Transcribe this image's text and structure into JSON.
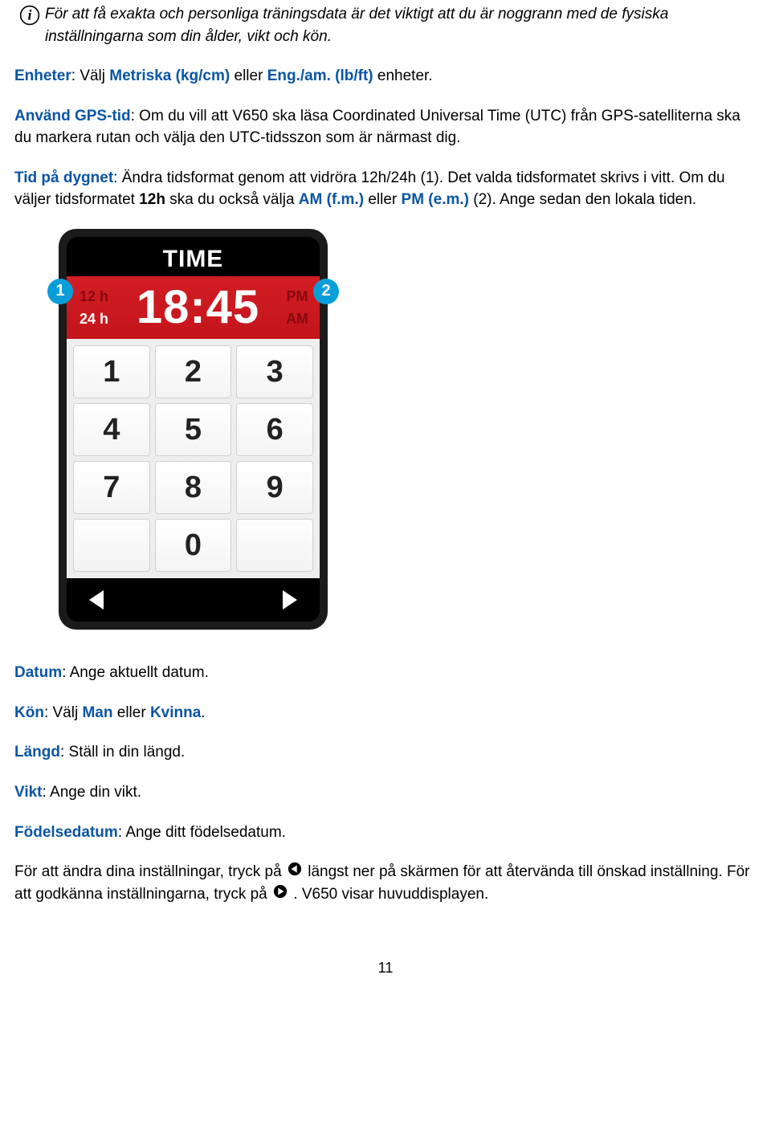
{
  "intro": {
    "line": "För att få exakta och personliga träningsdata är det viktigt att du är noggrann med de fysiska inställningarna som din ålder, vikt och kön."
  },
  "units": {
    "label": "Enheter",
    "sep": ": ",
    "text1": "Välj ",
    "option1": "Metriska (kg/cm)",
    "or": " eller ",
    "option2": "Eng./am. (lb/ft)",
    "text2": " enheter."
  },
  "gps": {
    "label": "Använd GPS-tid",
    "text": ": Om du vill att V650 ska läsa Coordinated Universal Time (UTC) från GPS-satelliterna ska du markera rutan och välja den UTC-tidsszon som är närmast dig."
  },
  "tod": {
    "label": "Tid på dygnet",
    "part1": ": Ändra tidsformat genom att vidröra 12h/24h (1). Det valda tidsformatet skrivs i vitt. Om du väljer tidsformatet ",
    "b1": "12h",
    "part2": " ska du också välja ",
    "b2": "AM (f.m.)",
    "or": " eller ",
    "b3": "PM (e.m.)",
    "part3": " (2). Ange sedan den lokala tiden."
  },
  "device": {
    "title": "TIME",
    "opt12h": "12 h",
    "opt24h": "24 h",
    "clock": "18:45",
    "pm": "PM",
    "am": "AM",
    "keys": [
      "1",
      "2",
      "3",
      "4",
      "5",
      "6",
      "7",
      "8",
      "9",
      "",
      "0",
      ""
    ]
  },
  "callouts": {
    "c1": "1",
    "c2": "2"
  },
  "datum": {
    "label": "Datum",
    "text": ": Ange aktuellt datum."
  },
  "kon": {
    "label": "Kön",
    "sep": ": ",
    "t1": "Välj ",
    "b1": "Man",
    "or": " eller ",
    "b2": "Kvinna",
    "t2": "."
  },
  "langd": {
    "label": "Längd",
    "text": ": Ställ in din längd."
  },
  "vikt": {
    "label": "Vikt",
    "text": ": Ange din vikt."
  },
  "fodelse": {
    "label": "Födelsedatum",
    "text": ": Ange ditt födelsedatum."
  },
  "final": {
    "p1": "För att ändra dina inställningar, tryck på ",
    "p2": " längst ner på skärmen för att återvända till önskad inställning. För att godkänna inställningarna, tryck på ",
    "p3": ". V650 visar huvuddisplayen."
  },
  "page_number": "11"
}
